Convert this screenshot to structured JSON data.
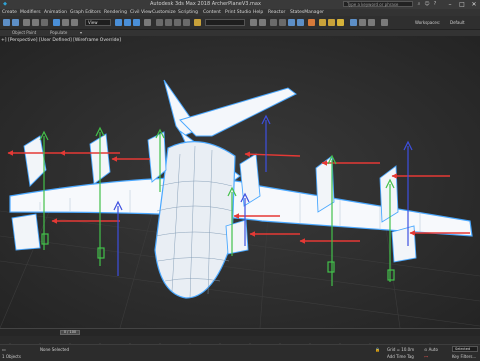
{
  "title_bar": {
    "title": "Autodesk 3ds Max 2018    ArcherPlaneV3.max",
    "search_placeholder": "Type a keyword or phrase"
  },
  "menu": [
    "Create",
    "Modifiers",
    "Animation",
    "Graph Editors",
    "Rendering",
    "Civil View",
    "Customize",
    "Scripting",
    "Content",
    "Print Studio",
    "Help",
    "Reactor",
    "StatesManager"
  ],
  "toolbar": {
    "selection_filter": "View",
    "workspace_label": "Workspaces:",
    "workspace_value": "Default"
  },
  "ribbon_tabs": [
    "Object Paint",
    "Populate"
  ],
  "viewport": {
    "label": "+] [Perspective] [User Defined] [Wireframe Override]"
  },
  "time": {
    "slider": "0 / 100"
  },
  "status": {
    "selection_count": "None Selected",
    "objects_label": "1 Objects",
    "add_time_tag": "Add Time Tag",
    "coordinates": "Grid = 10.0m",
    "set_key": "Selected",
    "key_filters": "Key Filters..."
  },
  "colors": {
    "wire_white": "#ffffff",
    "wire_outline": "#4aa8ff",
    "arrow_red": "#e53935",
    "arrow_green": "#43c04a",
    "arrow_blue": "#3d4fe0"
  }
}
